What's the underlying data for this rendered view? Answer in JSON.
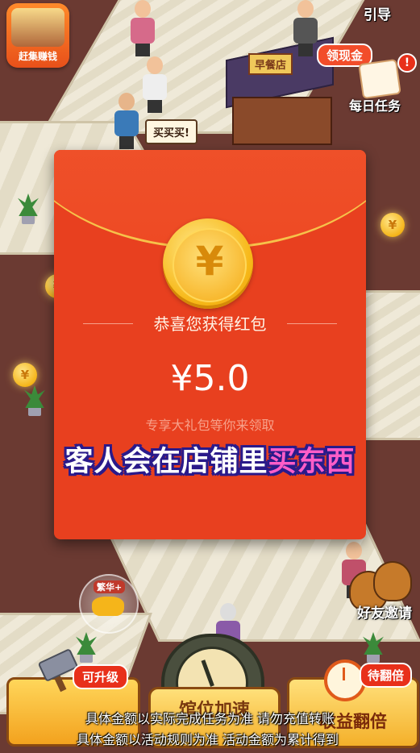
{
  "app": {
    "icon_label": "赶集赚钱"
  },
  "top_right": {
    "guide_label": "引导",
    "daily_badge": "领现金",
    "daily_label": "每日任务",
    "alert_mark": "!"
  },
  "map": {
    "shop_sign": "早餐店",
    "speech_bubble": "买买买!"
  },
  "red_packet": {
    "coin_glyph": "¥",
    "congrats": "恭喜您获得红包",
    "amount": "¥5.0",
    "subtitle": "专享大礼包等你来领取"
  },
  "caption": {
    "part1": "客人会在店铺里",
    "part2": "买东西"
  },
  "floating_coin_glyph": "¥",
  "ingot_tag": "繁华+",
  "friends": {
    "label": "好友邀请"
  },
  "bottom": {
    "upgrade_badge": "可升级",
    "center_label": "馆位加速",
    "double_badge": "待翻倍",
    "double_label": "收益翻倍"
  },
  "disclaimers": [
    "具体金额以实际完成任务为准 请勿充值转账",
    "具体金额以活动规则为准 活动金额为累计得到"
  ],
  "colors": {
    "envelope": "#e8401f",
    "coin": "#f7b818",
    "caption_outline": "#2a1a8a",
    "caption_highlight": "#ff5dc8"
  }
}
